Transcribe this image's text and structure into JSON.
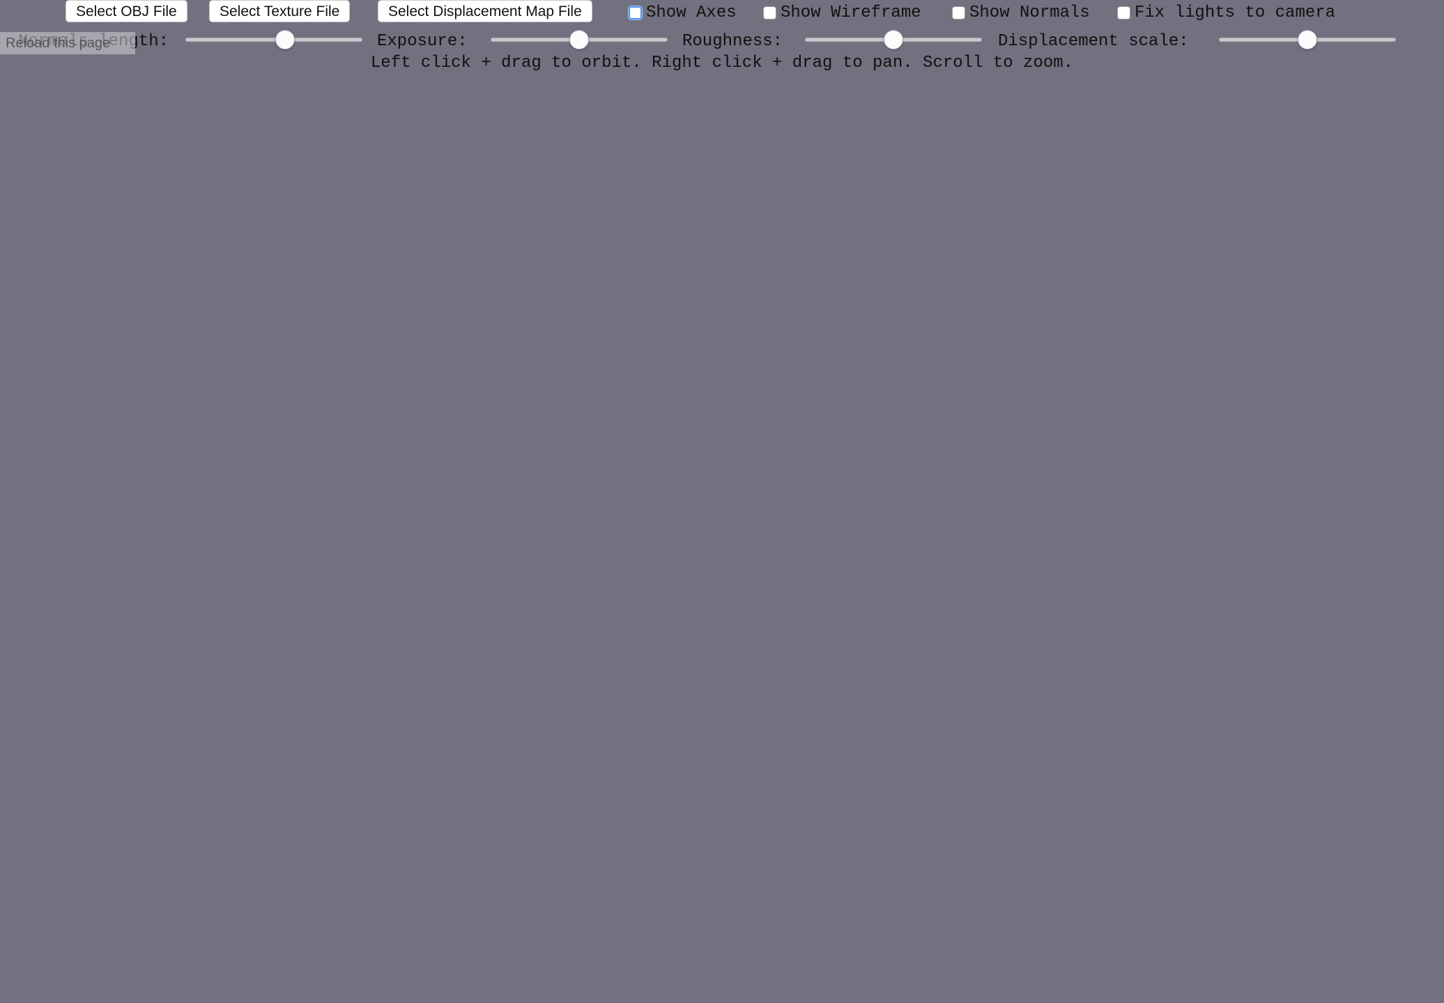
{
  "toolbar": {
    "select_obj_label": "Select OBJ File",
    "select_texture_label": "Select Texture File",
    "select_displacement_label": "Select Displacement Map File",
    "checkboxes": [
      {
        "label": "Show Axes",
        "checked": false
      },
      {
        "label": "Show Wireframe",
        "checked": false
      },
      {
        "label": "Show Normals",
        "checked": false
      },
      {
        "label": "Fix lights to camera",
        "checked": false
      }
    ]
  },
  "sliders": {
    "normals_length": {
      "label": "Normals length:",
      "value": 0.57
    },
    "exposure": {
      "label": "Exposure:",
      "value": 0.5
    },
    "roughness": {
      "label": "Roughness:",
      "value": 0.5
    },
    "displacement_scale": {
      "label": "Displacement scale:",
      "value": 0.5
    }
  },
  "overlay": {
    "reload_label": "Reload this page"
  },
  "hint": "Left click + drag to orbit. Right click + drag to pan. Scroll to zoom.",
  "viewport": {
    "background": "#71717f",
    "ocean_color": "#1f4f6e",
    "land_color": "#b89a6c",
    "vegetation_color": "#6f7d48"
  }
}
